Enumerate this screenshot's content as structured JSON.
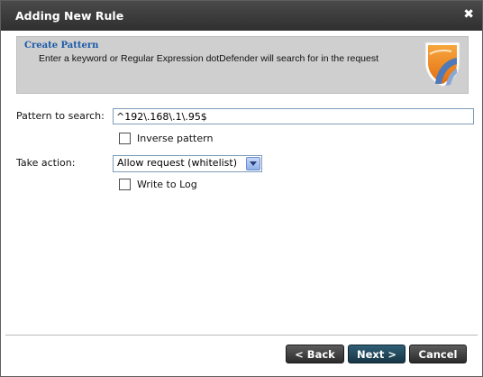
{
  "dialog": {
    "title": "Adding New Rule",
    "close_symbol": "✖"
  },
  "banner": {
    "title": "Create Pattern",
    "description": "Enter a keyword or Regular Expression dotDefender will search for in the request",
    "logo_icon": "shield-logo-icon"
  },
  "form": {
    "pattern_label": "Pattern to search:",
    "pattern_value": "^192\\.168\\.1\\.95$",
    "inverse_label": "Inverse pattern",
    "inverse_checked": false,
    "action_label": "Take action:",
    "action_selected": "Allow request (whitelist)",
    "write_log_label": "Write to Log",
    "write_log_checked": false
  },
  "buttons": {
    "back": "< Back",
    "next": "Next >",
    "cancel": "Cancel"
  },
  "colors": {
    "titlebar": "#3b3b3b",
    "banner_bg": "#cfcfcf",
    "banner_title": "#1a5aa8",
    "logo_orange": "#f08a1e",
    "logo_blue": "#4f79b8",
    "next_button": "#234a5e"
  }
}
